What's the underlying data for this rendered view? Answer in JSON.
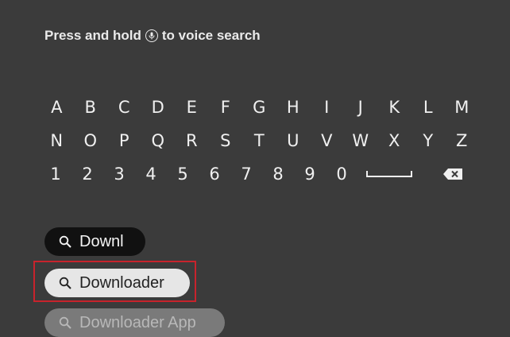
{
  "hint": {
    "before": "Press and hold",
    "after": "to voice search",
    "icon": "mic-icon"
  },
  "keyboard": {
    "rows": [
      [
        "A",
        "B",
        "C",
        "D",
        "E",
        "F",
        "G",
        "H",
        "I",
        "J",
        "K",
        "L",
        "M"
      ],
      [
        "N",
        "O",
        "P",
        "Q",
        "R",
        "S",
        "T",
        "U",
        "V",
        "W",
        "X",
        "Y",
        "Z"
      ],
      [
        "1",
        "2",
        "3",
        "4",
        "5",
        "6",
        "7",
        "8",
        "9",
        "0"
      ]
    ],
    "space_icon": "space-icon",
    "backspace_icon": "backspace-icon"
  },
  "results": {
    "query": "Downl",
    "suggestions": [
      "Downloader",
      "Downloader App"
    ],
    "selected_index": 0
  },
  "colors": {
    "background": "#3b3b3b",
    "highlight": "#c8232c",
    "selected_pill": "#e6e6e6"
  }
}
